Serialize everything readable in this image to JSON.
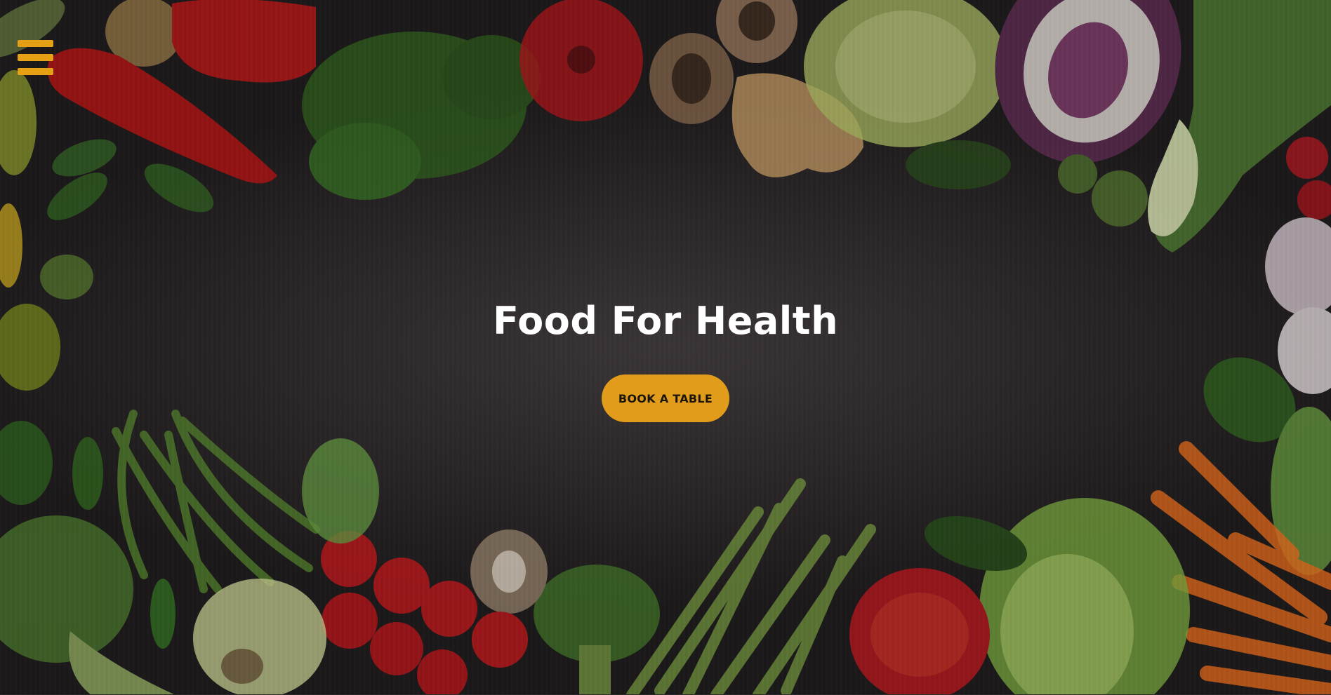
{
  "hero": {
    "title": "Food For Health",
    "cta_label": "BOOK A TABLE"
  },
  "menu": {
    "icon": "hamburger-menu-icon"
  },
  "colors": {
    "accent": "#e19c1b",
    "menu_icon": "#e5a016",
    "title_text": "#ffffff",
    "background": "#2a2628"
  }
}
